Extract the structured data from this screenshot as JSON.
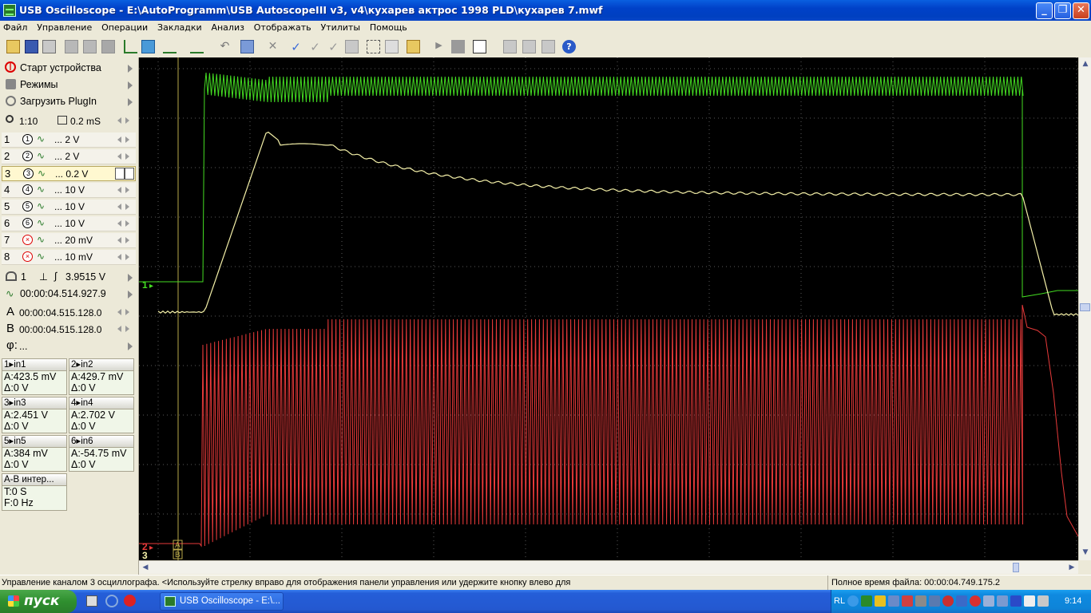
{
  "window": {
    "title": "USB Oscilloscope - E:\\AutoProgramm\\USB AutoscopeIII v3, v4\\кухарев актрос 1998 PLD\\кухарев 7.mwf",
    "min_label": "_",
    "max_label": "❐",
    "close_label": "✕"
  },
  "menu": [
    "Файл",
    "Управление",
    "Операции",
    "Закладки",
    "Анализ",
    "Отображать",
    "Утилиты",
    "Помощь"
  ],
  "toolbar_icons": [
    "open-icon",
    "save-icon",
    "print-icon",
    "copy-icon",
    "paste-icon",
    "tool-icon",
    "cursor-icon",
    "marker-icon",
    "channel-icon",
    "channel2-icon",
    "undo-icon",
    "zoom-icon",
    "delete-icon",
    "check-icon",
    "check2-icon",
    "check3-icon",
    "page-icon",
    "fit-icon",
    "select-icon",
    "folder-icon",
    "play-icon",
    "stop-icon",
    "text-icon",
    "graph-icon",
    "grid-icon",
    "grid2-icon",
    "help-icon"
  ],
  "left": {
    "start_device": "Старт устройства",
    "modes": "Режимы",
    "load_plugin": "Загрузить PlugIn",
    "zoom": "1:10",
    "timebase": "0.2 mS",
    "channels": [
      {
        "num": "1",
        "circle": "1",
        "sens": "... 2 V",
        "enabled": true
      },
      {
        "num": "2",
        "circle": "2",
        "sens": "... 2 V",
        "enabled": true
      },
      {
        "num": "3",
        "circle": "3",
        "sens": "... 0.2 V",
        "enabled": true
      },
      {
        "num": "4",
        "circle": "4",
        "sens": "... 10 V",
        "enabled": true
      },
      {
        "num": "5",
        "circle": "5",
        "sens": "... 10 V",
        "enabled": true
      },
      {
        "num": "6",
        "circle": "6",
        "sens": "... 10 V",
        "enabled": true
      },
      {
        "num": "7",
        "circle": "×",
        "sens": "... 20 mV",
        "enabled": false
      },
      {
        "num": "8",
        "circle": "×",
        "sens": "... 10 mV",
        "enabled": false
      }
    ],
    "trigger_channel": "1",
    "trigger_level": "3.9515 V",
    "trigger_time": "00:00:04.514.927.9",
    "cursor_a": "00:00:04.515.128.0",
    "cursor_b": "00:00:04.515.128.0",
    "phi": "...",
    "measurements": [
      {
        "head": "in1",
        "num": "1",
        "a": "A:423.5 mV",
        "d": "Δ:0 V"
      },
      {
        "head": "in2",
        "num": "2",
        "a": "A:429.7 mV",
        "d": "Δ:0 V"
      },
      {
        "head": "in3",
        "num": "3",
        "a": "A:2.451 V",
        "d": "Δ:0 V"
      },
      {
        "head": "in4",
        "num": "4",
        "a": "A:2.702 V",
        "d": "Δ:0 V"
      },
      {
        "head": "in5",
        "num": "5",
        "a": "A:384 mV",
        "d": "Δ:0 V"
      },
      {
        "head": "in6",
        "num": "6",
        "a": "A:-54.75 mV",
        "d": "Δ:0 V"
      }
    ],
    "interval": {
      "head": "A-B интер...",
      "t": "T:0 S",
      "f": "F:0 Hz"
    }
  },
  "scope": {
    "marker_1": "1",
    "marker_2": "2",
    "marker_3": "3",
    "cursor_a_label": "A",
    "cursor_b_label": "B",
    "colors": {
      "ch1": "#44dd22",
      "ch2": "#e83a3a",
      "ch3": "#f4f0a8",
      "grid": "#707070"
    }
  },
  "status": {
    "hint": "Управление каналом 3 осциллографа. <Используйте стрелку вправо для отображения панели управления или удержите кнопку влево для",
    "file_time": "Полное время файла: 00:00:04.749.175.2"
  },
  "taskbar": {
    "start": "пуск",
    "task": "USB Oscilloscope - E:\\...",
    "lang": "RL",
    "clock": "9:14"
  }
}
